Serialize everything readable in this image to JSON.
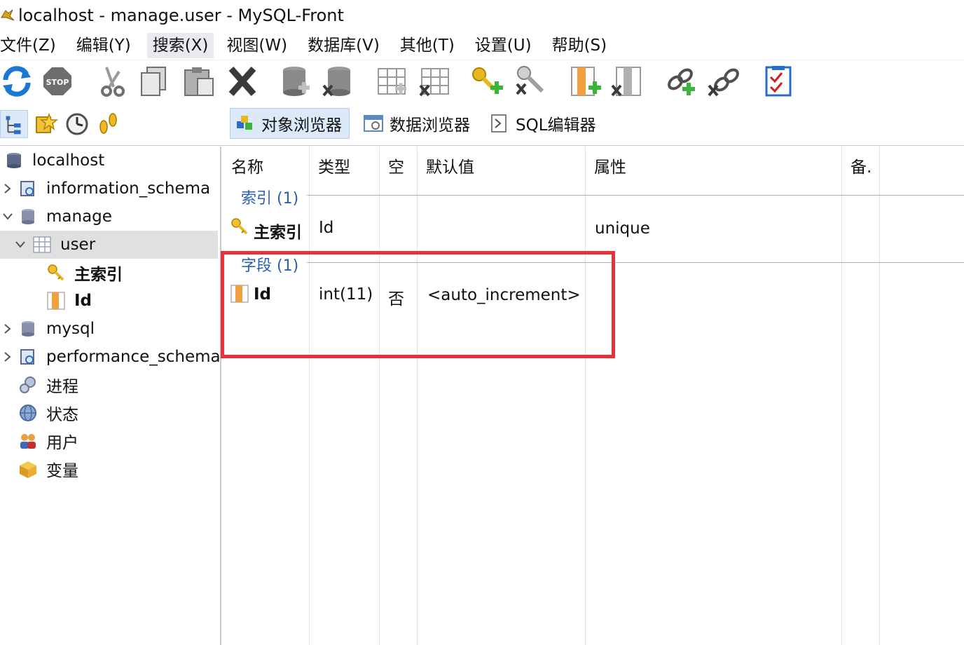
{
  "window": {
    "title": "localhost - manage.user - MySQL-Front",
    "app_icon": "mysql-front-dolphin-icon"
  },
  "menu": {
    "items": [
      "文件(Z)",
      "编辑(Y)",
      "搜索(X)",
      "视图(W)",
      "数据库(V)",
      "其他(T)",
      "设置(U)",
      "帮助(S)"
    ],
    "active_index": 2
  },
  "toolbar": {
    "buttons": [
      "refresh-icon",
      "stop-icon",
      "cut-icon",
      "copy-icon",
      "paste-icon",
      "delete-icon",
      "create-database-icon",
      "delete-database-icon",
      "create-table-icon",
      "delete-table-icon",
      "create-index-icon",
      "delete-index-icon",
      "create-field-icon",
      "delete-field-icon",
      "create-foreign-key-icon",
      "delete-foreign-key-icon",
      "properties-icon"
    ],
    "stop_text": "STOP"
  },
  "views": {
    "object_browser": "对象浏览器",
    "data_browser": "数据浏览器",
    "sql_editor": "SQL编辑器",
    "active": "object_browser"
  },
  "tree": {
    "root": "localhost",
    "items": [
      {
        "label": "information_schema",
        "type": "system-database"
      },
      {
        "label": "manage",
        "type": "database",
        "expanded": true
      },
      {
        "label": "user",
        "type": "table",
        "expanded": true,
        "selected": true
      },
      {
        "label": "主索引",
        "type": "index"
      },
      {
        "label": "Id",
        "type": "field"
      },
      {
        "label": "mysql",
        "type": "database"
      },
      {
        "label": "performance_schema",
        "type": "system-database"
      },
      {
        "label": "进程",
        "type": "processes"
      },
      {
        "label": "状态",
        "type": "status"
      },
      {
        "label": "用户",
        "type": "users"
      },
      {
        "label": "变量",
        "type": "variables"
      }
    ]
  },
  "table": {
    "headers": [
      "名称",
      "类型",
      "空",
      "默认值",
      "属性",
      "备."
    ],
    "groups": [
      {
        "label": "索引 (1)",
        "rows": [
          {
            "name": "主索引",
            "type": "Id",
            "null": "",
            "default": "",
            "attributes": "unique"
          }
        ]
      },
      {
        "label": "字段 (1)",
        "rows": [
          {
            "name": "Id",
            "type": "int(11)",
            "null": "否",
            "default": "<auto_increment>",
            "attributes": ""
          }
        ]
      }
    ]
  },
  "colors": {
    "group_label": "#2b5fb3",
    "highlight": "#e8323a",
    "selection": "#e0e0e0"
  }
}
